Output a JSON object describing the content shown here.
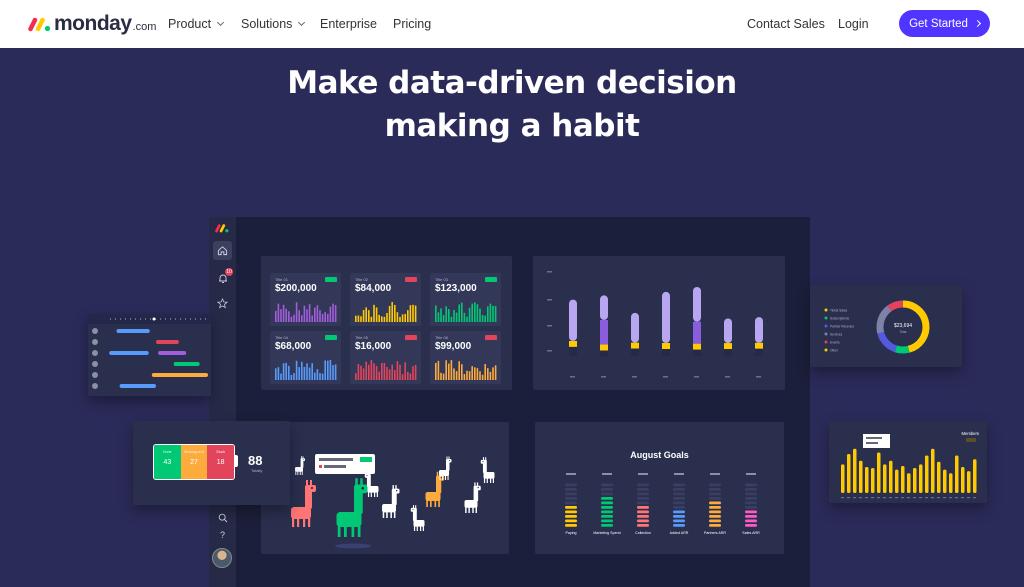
{
  "nav": {
    "logo_word": "monday",
    "logo_suffix": ".com",
    "items": [
      {
        "label": "Product",
        "dropdown": true
      },
      {
        "label": "Solutions",
        "dropdown": true
      },
      {
        "label": "Enterprise",
        "dropdown": false
      },
      {
        "label": "Pricing",
        "dropdown": false
      }
    ],
    "contact_sales": "Contact Sales",
    "login": "Login",
    "cta": "Get Started"
  },
  "hero": {
    "title_line1": "Make data-driven decision",
    "title_line2": "making a habit"
  },
  "colors": {
    "brand_primary": "#5034ff",
    "hero_bg": "#2b2b5a",
    "dashboard_bg": "#1c1f3b",
    "panel_bg": "#2a2f4e",
    "green": "#00c875",
    "orange": "#fdab3d",
    "red": "#e2445c",
    "yellow": "#ffcb00",
    "purple": "#a25ddc",
    "lavender": "#b9a6f0",
    "blue": "#579bfc"
  },
  "sidebar": {
    "icons": [
      "home-icon",
      "bell-icon",
      "star-icon",
      "search-icon",
      "help-icon"
    ]
  },
  "stat_cards": [
    {
      "title": "Title 01",
      "value": "$200,000",
      "badge": "up",
      "bar_color": "#a25ddc"
    },
    {
      "title": "Title 02",
      "value": "$84,000",
      "badge": "down",
      "bar_color": "#ffcb00"
    },
    {
      "title": "Title 03",
      "value": "$123,000",
      "badge": "up",
      "bar_color": "#00c875"
    },
    {
      "title": "Title 04",
      "value": "$68,000",
      "badge": "up",
      "bar_color": "#579bfc"
    },
    {
      "title": "Title 05",
      "value": "$16,000",
      "badge": "down",
      "bar_color": "#e2445c"
    },
    {
      "title": "Title 06",
      "value": "$99,000",
      "badge": "down",
      "bar_color": "#fdab3d"
    }
  ],
  "stacked_bars": [
    {
      "total": 0.72,
      "top": 0.82,
      "mid": 0.0
    },
    {
      "total": 0.78,
      "top": 0.45,
      "mid": 0.45
    },
    {
      "total": 0.53,
      "top": 0.8,
      "mid": 0.0
    },
    {
      "total": 0.83,
      "top": 0.88,
      "mid": 0.0
    },
    {
      "total": 0.9,
      "top": 0.55,
      "mid": 0.35
    },
    {
      "total": 0.45,
      "top": 0.78,
      "mid": 0.0
    },
    {
      "total": 0.47,
      "top": 0.78,
      "mid": 0.0
    }
  ],
  "battery": {
    "segments": [
      {
        "label": "Done",
        "value": "43",
        "color": "#00c875"
      },
      {
        "label": "Working on it",
        "value": "27",
        "color": "#fdab3d"
      },
      {
        "label": "Stuck",
        "value": "18",
        "color": "#e2445c"
      }
    ],
    "total": "88",
    "total_label": "Totally"
  },
  "donut": {
    "center_value": "$23,694",
    "center_label": "Total",
    "legend": [
      "Ticket Sales",
      "Subscriptions",
      "Partner Revenue",
      "Services",
      "Events",
      "Other"
    ],
    "slices": [
      {
        "value": 46,
        "color": "#ffcb00"
      },
      {
        "value": 9,
        "color": "#00c875"
      },
      {
        "value": 16,
        "color": "#5559df"
      },
      {
        "value": 19,
        "color": "#7e82a6"
      },
      {
        "value": 10,
        "color": "#e2445c"
      }
    ]
  },
  "yellow_chart": {
    "title": "Members",
    "values": [
      0.55,
      0.75,
      0.85,
      0.62,
      0.5,
      0.48,
      0.78,
      0.55,
      0.62,
      0.45,
      0.52,
      0.38,
      0.48,
      0.55,
      0.72,
      0.85,
      0.6,
      0.45,
      0.38,
      0.72,
      0.5,
      0.42,
      0.65
    ]
  },
  "gantt": {
    "bars": [
      {
        "row": 0,
        "start": 0.12,
        "len": 0.32,
        "color": "#579bfc"
      },
      {
        "row": 1,
        "start": 0.5,
        "len": 0.22,
        "color": "#e2445c"
      },
      {
        "row": 2,
        "start": 0.05,
        "len": 0.38,
        "color": "#579bfc"
      },
      {
        "row": 2,
        "start": 0.52,
        "len": 0.27,
        "color": "#a25ddc"
      },
      {
        "row": 3,
        "start": 0.67,
        "len": 0.25,
        "color": "#00c875"
      },
      {
        "row": 4,
        "start": 0.46,
        "len": 0.54,
        "color": "#fdab3d"
      },
      {
        "row": 5,
        "start": 0.15,
        "len": 0.35,
        "color": "#579bfc"
      }
    ]
  },
  "goals": {
    "title": "August Goals",
    "columns": [
      {
        "label": "Paying",
        "color": "#ffcb00",
        "lit": 5
      },
      {
        "label": "Marketing Spend",
        "color": "#00c875",
        "lit": 7
      },
      {
        "label": "Collection",
        "color": "#ff7575",
        "lit": 5
      },
      {
        "label": "Added ARR",
        "color": "#579bfc",
        "lit": 4
      },
      {
        "label": "Partners ARR",
        "color": "#fdab3d",
        "lit": 6
      },
      {
        "label": "Sales ARR",
        "color": "#ff5ac4",
        "lit": 4
      }
    ]
  }
}
